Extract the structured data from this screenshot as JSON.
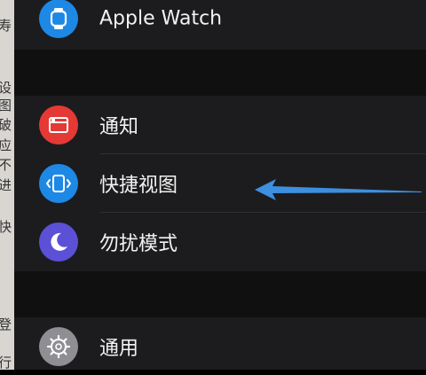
{
  "background_text": [
    "寿",
    "设",
    "图",
    "破",
    "应",
    "不",
    "进",
    "快",
    "登",
    "行"
  ],
  "settings": {
    "items": [
      {
        "label": "Apple Watch",
        "icon": "apple-watch-icon",
        "color": "#1e88e5"
      },
      {
        "label": "通知",
        "icon": "notifications-icon",
        "color": "#e53935"
      },
      {
        "label": "快捷视图",
        "icon": "glances-icon",
        "color": "#1e88e5"
      },
      {
        "label": "勿扰模式",
        "icon": "moon-icon",
        "color": "#5b50d6"
      },
      {
        "label": "通用",
        "icon": "gear-icon",
        "color": "#8e8e93"
      }
    ]
  },
  "annotation": {
    "arrow_color": "#3d8fe0"
  }
}
